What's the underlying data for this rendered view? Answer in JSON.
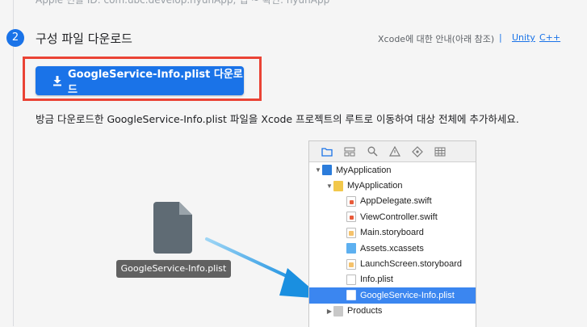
{
  "top_text": "Apple 번들 ID: com.ubc.develop.hyunApp, 앱 ~ 확인: hyunApp",
  "step": {
    "number": "2",
    "title": "구성 파일 다운로드"
  },
  "hint": "Xcode에 대한 안내(아래 참조)",
  "separator": "|",
  "links": {
    "unity": "Unity",
    "cpp": "C++"
  },
  "download_button": {
    "label": "GoogleService-Info.plist 다운로드",
    "icon": "download-icon"
  },
  "description": "방금 다운로드한 GoogleService-Info.plist 파일을 Xcode 프로젝트의 루트로 이동하여 대상 전체에 추가하세요.",
  "file_badge": "GoogleService-Info.plist",
  "navigator": {
    "toolbar_icons": [
      "folder-icon",
      "hierarchy-icon",
      "search-icon",
      "warning-icon",
      "diamond-icon",
      "grid-icon"
    ],
    "rows": [
      {
        "label": "MyApplication",
        "indent": 0,
        "tri": "▼",
        "icon": "proj"
      },
      {
        "label": "MyApplication",
        "indent": 1,
        "tri": "▼",
        "icon": "folder"
      },
      {
        "label": "AppDelegate.swift",
        "indent": 2,
        "tri": "",
        "icon": "swift"
      },
      {
        "label": "ViewController.swift",
        "indent": 2,
        "tri": "",
        "icon": "swift"
      },
      {
        "label": "Main.storyboard",
        "indent": 2,
        "tri": "",
        "icon": "story"
      },
      {
        "label": "Assets.xcassets",
        "indent": 2,
        "tri": "",
        "icon": "assets"
      },
      {
        "label": "LaunchScreen.storyboard",
        "indent": 2,
        "tri": "",
        "icon": "story"
      },
      {
        "label": "Info.plist",
        "indent": 2,
        "tri": "",
        "icon": "plist"
      },
      {
        "label": "GoogleService-Info.plist",
        "indent": 2,
        "tri": "",
        "icon": "plist-sel",
        "selected": true
      },
      {
        "label": "Products",
        "indent": 1,
        "tri": "▶",
        "icon": "products"
      }
    ]
  },
  "colors": {
    "accent": "#1a73e8",
    "highlight": "#ea4335",
    "selection": "#3b86f0"
  }
}
